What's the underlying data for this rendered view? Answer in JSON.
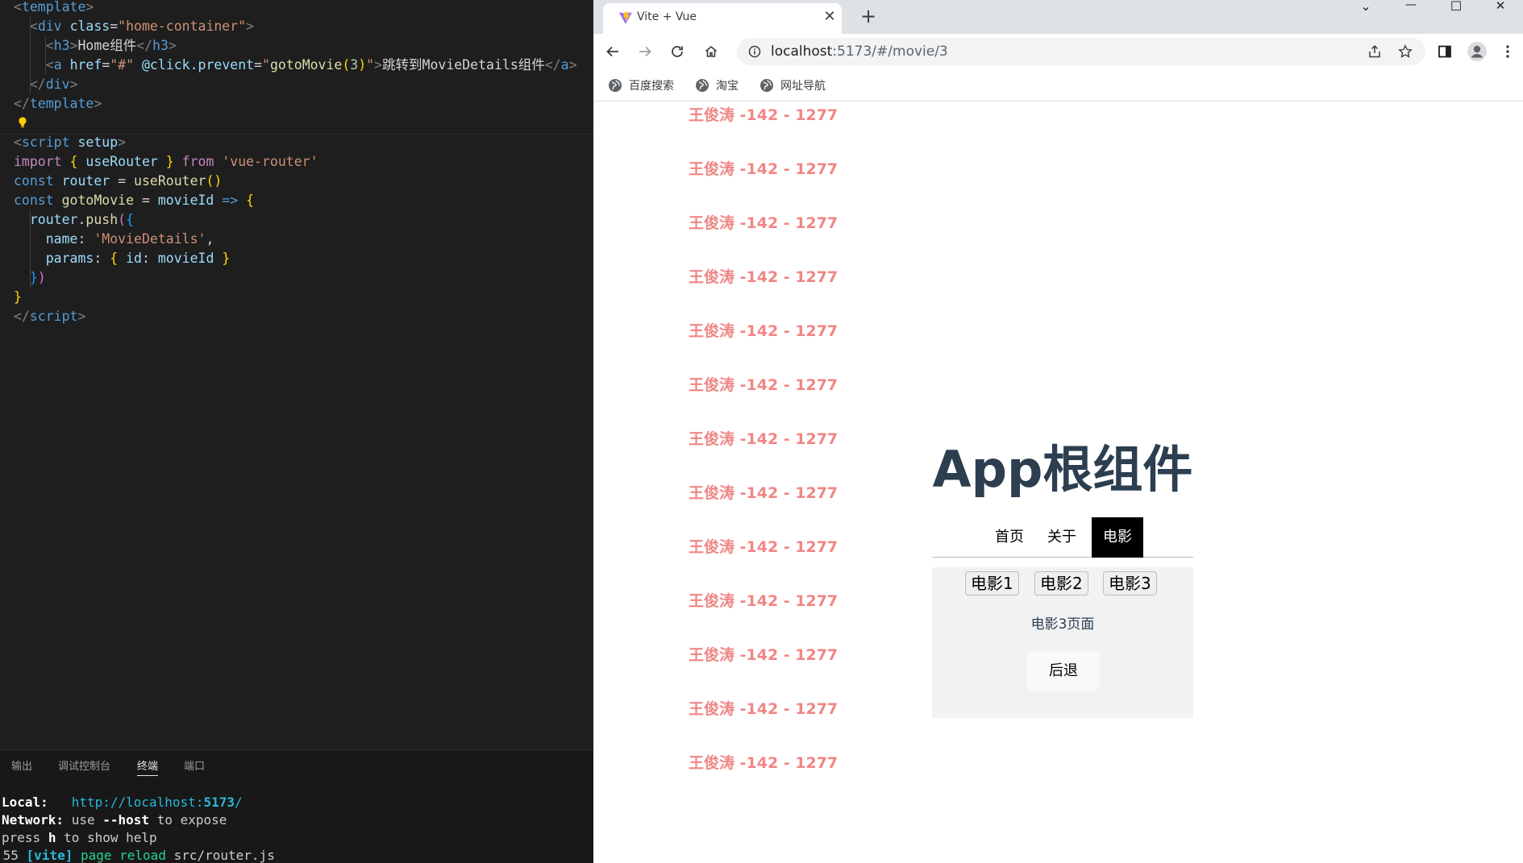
{
  "editor": {
    "lines": [
      {
        "k": "tpl_open",
        "parts": [
          [
            "tok-punc",
            "<"
          ],
          [
            "tok-tag",
            "template"
          ],
          [
            "tok-punc",
            ">"
          ]
        ]
      },
      {
        "k": "div_open",
        "parts": [
          [
            "tok-text",
            "  "
          ],
          [
            "tok-punc",
            "<"
          ],
          [
            "tok-tag",
            "div"
          ],
          [
            "tok-text",
            " "
          ],
          [
            "tok-attr",
            "class"
          ],
          [
            "tok-text",
            "="
          ],
          [
            "tok-str",
            "\"home-container\""
          ],
          [
            "tok-punc",
            ">"
          ]
        ]
      },
      {
        "k": "h3",
        "parts": [
          [
            "tok-text",
            "    "
          ],
          [
            "tok-punc",
            "<"
          ],
          [
            "tok-tag",
            "h3"
          ],
          [
            "tok-punc",
            ">"
          ],
          [
            "tok-text",
            "Home组件"
          ],
          [
            "tok-punc",
            "</"
          ],
          [
            "tok-tag",
            "h3"
          ],
          [
            "tok-punc",
            ">"
          ]
        ]
      },
      {
        "k": "a",
        "parts": [
          [
            "tok-text",
            "    "
          ],
          [
            "tok-punc",
            "<"
          ],
          [
            "tok-tag",
            "a"
          ],
          [
            "tok-text",
            " "
          ],
          [
            "tok-attr",
            "href"
          ],
          [
            "tok-text",
            "="
          ],
          [
            "tok-str",
            "\"#\""
          ],
          [
            "tok-text",
            " "
          ],
          [
            "tok-attr",
            "@click.prevent"
          ],
          [
            "tok-text",
            "="
          ],
          [
            "tok-str",
            "\""
          ],
          [
            "tok-fn",
            "gotoMovie"
          ],
          [
            "tok-gold",
            "("
          ],
          [
            "tok-num",
            "3"
          ],
          [
            "tok-gold",
            ")"
          ],
          [
            "tok-str",
            "\""
          ],
          [
            "tok-punc",
            ">"
          ],
          [
            "tok-text",
            "跳转到MovieDetails组件"
          ],
          [
            "tok-punc",
            "</"
          ],
          [
            "tok-tag",
            "a"
          ],
          [
            "tok-punc",
            ">"
          ]
        ]
      },
      {
        "k": "div_close",
        "parts": [
          [
            "tok-text",
            "  "
          ],
          [
            "tok-punc",
            "</"
          ],
          [
            "tok-tag",
            "div"
          ],
          [
            "tok-punc",
            ">"
          ]
        ]
      },
      {
        "k": "tpl_close",
        "parts": [
          [
            "tok-punc",
            "</"
          ],
          [
            "tok-tag",
            "template"
          ],
          [
            "tok-punc",
            ">"
          ]
        ]
      },
      {
        "k": "blank",
        "parts": []
      },
      {
        "k": "script_open",
        "parts": [
          [
            "tok-punc",
            "<"
          ],
          [
            "tok-tag",
            "script"
          ],
          [
            "tok-text",
            " "
          ],
          [
            "tok-attr",
            "setup"
          ],
          [
            "tok-punc",
            ">"
          ]
        ]
      },
      {
        "k": "import",
        "parts": [
          [
            "tok-kw",
            "import"
          ],
          [
            "tok-text",
            " "
          ],
          [
            "tok-brace",
            "{"
          ],
          [
            "tok-text",
            " "
          ],
          [
            "tok-var",
            "useRouter"
          ],
          [
            "tok-text",
            " "
          ],
          [
            "tok-brace",
            "}"
          ],
          [
            "tok-text",
            " "
          ],
          [
            "tok-kw",
            "from"
          ],
          [
            "tok-text",
            " "
          ],
          [
            "tok-str",
            "'vue-router'"
          ]
        ]
      },
      {
        "k": "const1",
        "parts": [
          [
            "tok-kw2",
            "const"
          ],
          [
            "tok-text",
            " "
          ],
          [
            "tok-var",
            "router"
          ],
          [
            "tok-text",
            " = "
          ],
          [
            "tok-fn",
            "useRouter"
          ],
          [
            "tok-brace",
            "()"
          ]
        ]
      },
      {
        "k": "const2",
        "parts": [
          [
            "tok-kw2",
            "const"
          ],
          [
            "tok-text",
            " "
          ],
          [
            "tok-fn",
            "gotoMovie"
          ],
          [
            "tok-text",
            " = "
          ],
          [
            "tok-var",
            "movieId"
          ],
          [
            "tok-text",
            " "
          ],
          [
            "tok-kw2",
            "=>"
          ],
          [
            "tok-text",
            " "
          ],
          [
            "tok-brace",
            "{"
          ]
        ]
      },
      {
        "k": "push",
        "parts": [
          [
            "tok-text",
            "  "
          ],
          [
            "tok-var",
            "router"
          ],
          [
            "tok-text",
            "."
          ],
          [
            "tok-fn",
            "push"
          ],
          [
            "tok-brace2",
            "("
          ],
          [
            "tok-brace3",
            "{"
          ]
        ]
      },
      {
        "k": "name",
        "parts": [
          [
            "tok-text",
            "    "
          ],
          [
            "tok-var",
            "name"
          ],
          [
            "tok-text",
            ": "
          ],
          [
            "tok-str",
            "'MovieDetails'"
          ],
          [
            "tok-text",
            ","
          ]
        ]
      },
      {
        "k": "params",
        "parts": [
          [
            "tok-text",
            "    "
          ],
          [
            "tok-var",
            "params"
          ],
          [
            "tok-text",
            ": "
          ],
          [
            "tok-brace",
            "{"
          ],
          [
            "tok-text",
            " "
          ],
          [
            "tok-var",
            "id"
          ],
          [
            "tok-text",
            ": "
          ],
          [
            "tok-var",
            "movieId"
          ],
          [
            "tok-text",
            " "
          ],
          [
            "tok-brace",
            "}"
          ]
        ]
      },
      {
        "k": "close_push",
        "parts": [
          [
            "tok-text",
            "  "
          ],
          [
            "tok-brace3",
            "}"
          ],
          [
            "tok-brace2",
            ")"
          ]
        ]
      },
      {
        "k": "close_fn",
        "parts": [
          [
            "tok-brace",
            "}"
          ]
        ]
      },
      {
        "k": "script_close",
        "parts": [
          [
            "tok-punc",
            "</"
          ],
          [
            "tok-tag",
            "script"
          ],
          [
            "tok-punc",
            ">"
          ]
        ]
      }
    ]
  },
  "panel": {
    "tabs": [
      "输出",
      "调试控制台",
      "终端",
      "端口"
    ],
    "active_tab": "终端",
    "terminal": {
      "local_label": "Local:",
      "local_url_prefix": "http://localhost:",
      "local_url_port": "5173",
      "local_url_suffix": "/",
      "network_label": "Network:",
      "network_use": "use",
      "network_flag": "--host",
      "network_rest": "to expose",
      "press_text": "press",
      "press_key": "h",
      "press_rest": "to show help",
      "log_time": ":55",
      "log_tag": "[vite]",
      "log_event": "page reload",
      "log_file": "src/router.js"
    }
  },
  "browser": {
    "tab_title": "Vite + Vue",
    "tab_close": "✕",
    "new_tab": "+",
    "win_controls": [
      "⌄",
      "—",
      "☐",
      "✕"
    ],
    "url_host": "localhost",
    "url_rest": ":5173/#/movie/3",
    "bookmarks": [
      "百度搜索",
      "淘宝",
      "网址导航"
    ],
    "icons": [
      "back-icon",
      "forward-icon",
      "reload-icon",
      "home-icon",
      "info-icon",
      "share-icon",
      "star-icon",
      "sidepanel-icon",
      "profile-icon",
      "menu-icon",
      "globe-icon"
    ],
    "watermark_text": "王俊涛 -142 - 1277",
    "app": {
      "title": "App根组件",
      "nav": [
        "首页",
        "关于",
        "电影"
      ],
      "active_nav": "电影",
      "movie_buttons": [
        "电影1",
        "电影2",
        "电影3"
      ],
      "movie_page_text": "电影3页面",
      "back_label": "后退"
    }
  },
  "colors": {
    "watermark": "#f08080",
    "title": "#2c3e50",
    "active_nav_bg": "#000000"
  }
}
